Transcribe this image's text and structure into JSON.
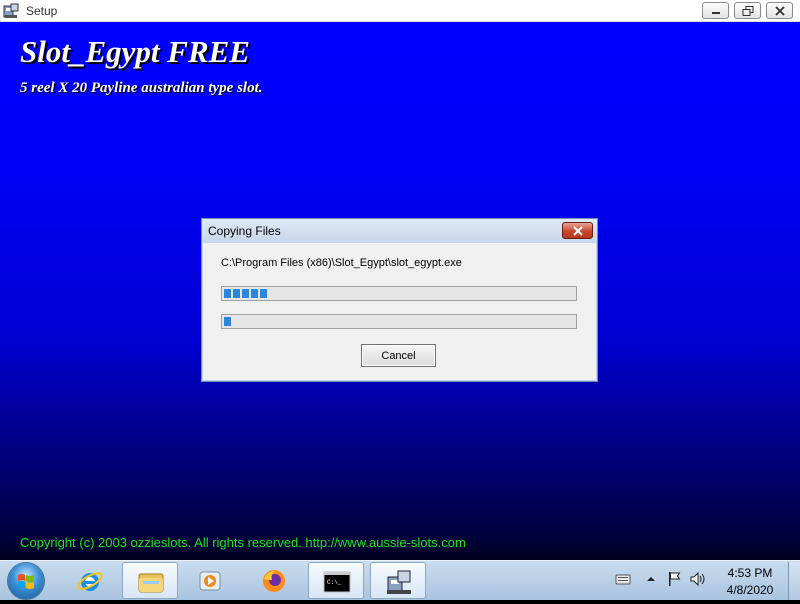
{
  "window": {
    "title": "Setup"
  },
  "setup": {
    "app_title": "Slot_Egypt FREE",
    "subtitle": "5 reel X 20 Payline australian type slot.",
    "copyright": "Copyright (c) 2003 ozzieslots. All rights reserved. http://www.aussie-slots.com"
  },
  "dialog": {
    "title": "Copying Files",
    "current_file": "C:\\Program Files (x86)\\Slot_Egypt\\slot_egypt.exe",
    "file_progress_percent": 14,
    "overall_progress_percent": 2,
    "cancel_label": "Cancel"
  },
  "taskbar": {
    "items": [
      "start",
      "internet-explorer",
      "file-explorer",
      "media-player",
      "firefox",
      "command-prompt",
      "setup"
    ],
    "clock_time": "4:53 PM",
    "clock_date": "4/8/2020"
  },
  "colors": {
    "background": "#0000ff",
    "copyright_text": "#19e619",
    "progress_fill": "#2b86dd"
  }
}
